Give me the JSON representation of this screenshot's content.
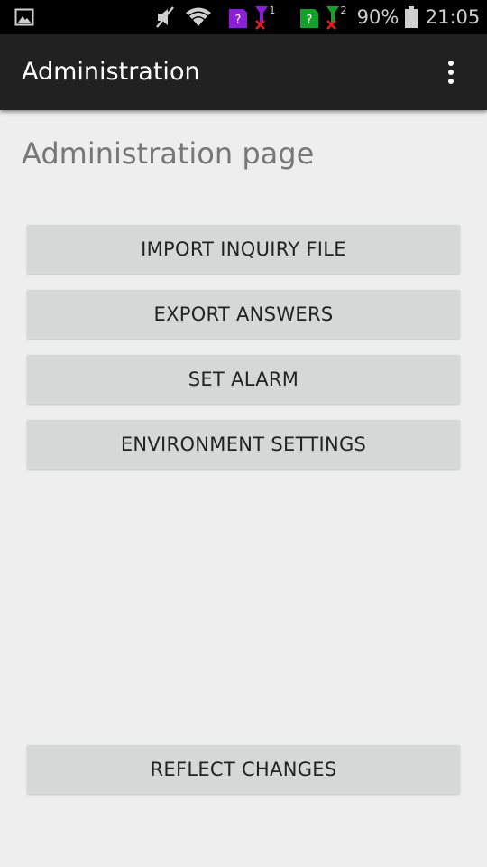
{
  "status_bar": {
    "battery_percent": "90%",
    "time": "21:05",
    "sim1_badge": "?",
    "sim2_badge": "?",
    "sim1_index": "1",
    "sim2_index": "2",
    "icons": [
      "image-icon",
      "mute-icon",
      "wifi-icon",
      "sim1-card-icon",
      "signal1-icon",
      "sim2-card-icon",
      "signal2-icon",
      "battery-icon"
    ],
    "colors": {
      "sim1_card": "#8a1fd6",
      "sim2_card": "#12a22a",
      "no_signal_x": "#e0201b"
    }
  },
  "app_bar": {
    "title": "Administration",
    "overflow_icon": "more-vert-icon"
  },
  "main": {
    "heading": "Administration page",
    "buttons": {
      "import": "IMPORT INQUIRY FILE",
      "export": "EXPORT ANSWERS",
      "alarm": "SET ALARM",
      "environment": "ENVIRONMENT SETTINGS",
      "reflect": "REFLECT CHANGES"
    }
  }
}
